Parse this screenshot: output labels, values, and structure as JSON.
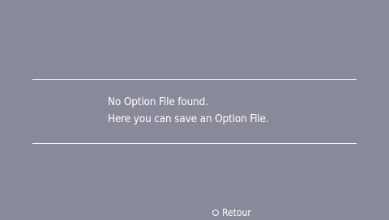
{
  "message": {
    "line1": "No Option File found.",
    "line2": "Here you can save an Option File."
  },
  "footer": {
    "back_icon": "circle-button-icon",
    "back_label": "Retour"
  },
  "colors": {
    "background": "#888999",
    "text": "#ffffff",
    "divider": "#ffffff"
  }
}
